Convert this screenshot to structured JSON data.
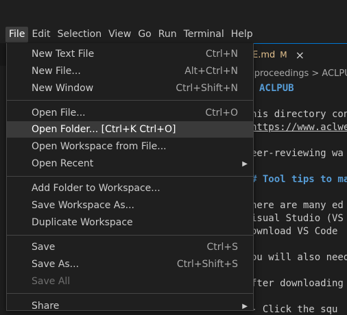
{
  "menubar": {
    "items": [
      {
        "label": "File"
      },
      {
        "label": "Edit"
      },
      {
        "label": "Selection"
      },
      {
        "label": "View"
      },
      {
        "label": "Go"
      },
      {
        "label": "Run"
      },
      {
        "label": "Terminal"
      },
      {
        "label": "Help"
      }
    ]
  },
  "editor": {
    "tab": {
      "filename": "E.md",
      "status": "M",
      "close": "×"
    },
    "breadcrumb": "-proceedings > ACLPUB",
    "lines": [
      "ACLPUB",
      "his directory con",
      "https://www.aclweb",
      "eer-reviewing wa",
      "# Tool tips to ma",
      "here are many ed",
      "isual Studio (VS",
      "ownload VS Code",
      "ou will also need",
      "fter downloading",
      "- Click the squ"
    ]
  },
  "file_menu": {
    "items": [
      {
        "label": "New Text File",
        "shortcut": "Ctrl+N"
      },
      {
        "label": "New File...",
        "shortcut": "Alt+Ctrl+N"
      },
      {
        "label": "New Window",
        "shortcut": "Ctrl+Shift+N"
      },
      {
        "label": "Open File...",
        "shortcut": "Ctrl+O"
      },
      {
        "label": "Open Folder... [Ctrl+K Ctrl+O]",
        "shortcut": ""
      },
      {
        "label": "Open Workspace from File...",
        "shortcut": ""
      },
      {
        "label": "Open Recent",
        "shortcut": ""
      },
      {
        "label": "Add Folder to Workspace...",
        "shortcut": ""
      },
      {
        "label": "Save Workspace As...",
        "shortcut": ""
      },
      {
        "label": "Duplicate Workspace",
        "shortcut": ""
      },
      {
        "label": "Save",
        "shortcut": "Ctrl+S"
      },
      {
        "label": "Save As...",
        "shortcut": "Ctrl+Shift+S"
      },
      {
        "label": "Save All",
        "shortcut": ""
      },
      {
        "label": "Share",
        "shortcut": ""
      }
    ]
  },
  "colors": {
    "background": "#1e1e1e",
    "menu_background": "#1f1f1f",
    "hover": "#3a3a3a",
    "accent": "#0078d4",
    "modified": "#e2c08d"
  }
}
